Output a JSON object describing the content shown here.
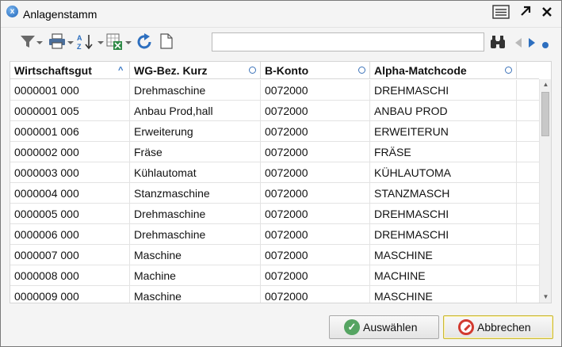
{
  "window": {
    "title": "Anlagenstamm"
  },
  "titlebar": {
    "icons": [
      "app-logo-icon",
      "menu-list-icon",
      "maximize-arrow-icon",
      "close-icon"
    ]
  },
  "toolbar": {
    "icons": [
      "filter-icon",
      "print-icon",
      "sort-az-icon",
      "excel-export-icon",
      "refresh-icon",
      "new-document-icon",
      "binoculars-search-icon",
      "prev-arrow-icon",
      "next-arrow-icon",
      "dot-icon"
    ],
    "search": {
      "value": "",
      "placeholder": ""
    }
  },
  "grid": {
    "columns": [
      "Wirtschaftsgut",
      "WG-Bez. Kurz",
      "B-Konto",
      "Alpha-Matchcode"
    ],
    "rows": [
      [
        "0000001 000",
        "Drehmaschine",
        "0072000",
        "DREHMASCHI"
      ],
      [
        "0000001 005",
        "Anbau Prod,hall",
        "0072000",
        "ANBAU PROD"
      ],
      [
        "0000001 006",
        "Erweiterung",
        "0072000",
        "ERWEITERUN"
      ],
      [
        "0000002 000",
        "Fräse",
        "0072000",
        "FRÄSE"
      ],
      [
        "0000003 000",
        "Kühlautomat",
        "0072000",
        "KÜHLAUTOMA"
      ],
      [
        "0000004 000",
        "Stanzmaschine",
        "0072000",
        "STANZMASCH"
      ],
      [
        "0000005 000",
        "Drehmaschine",
        "0072000",
        "DREHMASCHI"
      ],
      [
        "0000006 000",
        "Drehmaschine",
        "0072000",
        "DREHMASCHI"
      ],
      [
        "0000007 000",
        "Maschine",
        "0072000",
        "MASCHINE"
      ],
      [
        "0000008 000",
        "Machine",
        "0072000",
        "MACHINE"
      ],
      [
        "0000009 000",
        "Maschine",
        "0072000",
        "MASCHINE"
      ]
    ]
  },
  "buttons": {
    "select_label": "Auswählen",
    "cancel_label": "Abbrechen"
  },
  "colors": {
    "accent_blue": "#2d6fbf",
    "ok_green": "#55a462",
    "cancel_red": "#d23a30"
  }
}
